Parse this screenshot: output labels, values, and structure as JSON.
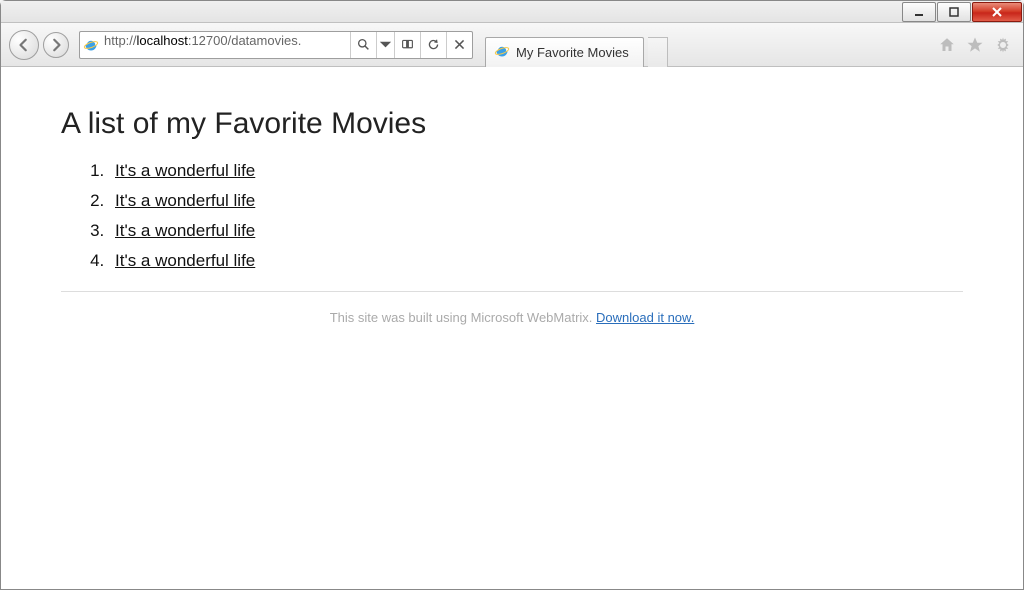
{
  "window": {
    "minimize_aria": "Minimize",
    "maximize_aria": "Maximize",
    "close_aria": "Close"
  },
  "toolbar": {
    "back_aria": "Back",
    "forward_aria": "Forward",
    "url_prefix": "http://",
    "url_host": "localhost",
    "url_rest": ":12700/datamovies.",
    "search_aria": "Search",
    "dropdown_aria": "Dropdown",
    "compat_aria": "Compatibility View",
    "refresh_aria": "Refresh",
    "stop_aria": "Stop",
    "tab_title": "My Favorite Movies",
    "newtab_aria": "New Tab",
    "home_aria": "Home",
    "favorites_aria": "Favorites",
    "tools_aria": "Tools"
  },
  "page": {
    "heading": "A list of my Favorite Movies",
    "movies": [
      "It's a wonderful life",
      "It's a wonderful life",
      "It's a wonderful life",
      "It's a wonderful life"
    ],
    "footer_text": "This site was built using Microsoft WebMatrix. ",
    "footer_link": "Download it now."
  }
}
